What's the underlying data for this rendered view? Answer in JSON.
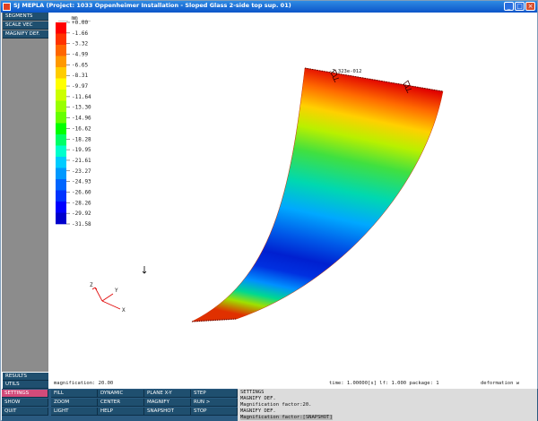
{
  "window": {
    "title": "SJ MEPLA (Project: 1033 Oppenheimer Installation - Sloped Glass 2-side top sup. 01)",
    "min": "_",
    "max": "□",
    "close": "×"
  },
  "sidebar": {
    "top_items": [
      "SEGMENTS",
      "SCALE VEC",
      "MAGNIFY DEF."
    ],
    "bottom_items": [
      "RESULTS",
      "UTILS",
      "SETTINGS",
      "SHOW",
      "QUIT"
    ]
  },
  "legend": {
    "unit": "___ mm ___",
    "colors": [
      "#ff0000",
      "#ff3300",
      "#ff6600",
      "#ff9900",
      "#ffcc00",
      "#ffff00",
      "#ccff00",
      "#99ff00",
      "#66ff00",
      "#00ff00",
      "#00ff66",
      "#00ffcc",
      "#00ccff",
      "#0099ff",
      "#0066ff",
      "#0033ff",
      "#0000ff",
      "#0000cc"
    ],
    "values": [
      "+0.00",
      "-1.66",
      "-3.32",
      "-4.99",
      "-6.65",
      "-8.31",
      "-9.97",
      "-11.64",
      "-13.30",
      "-14.96",
      "-16.62",
      "-18.28",
      "-19.95",
      "-21.61",
      "-23.27",
      "-24.93",
      "-26.60",
      "-28.26",
      "-29.92",
      "-31.58"
    ]
  },
  "plot": {
    "annotation_max": "-7.323e-012",
    "axis_x": "X",
    "axis_y": "Y",
    "axis_z": "Z"
  },
  "status": {
    "magnification": "magnification: 20.00",
    "time": "time:  1.00000[s] lf:  1.000 package: 1",
    "mode": "deformation w"
  },
  "menu": {
    "columns": [
      [
        "FILL",
        "ZOOM",
        "LIGHT"
      ],
      [
        "DYNAMIC",
        "CENTER",
        "HELP"
      ],
      [
        "PLANE X-Y",
        "MAGNIFY",
        "SNAPSHOT"
      ],
      [
        "STEP",
        "RUN  >",
        "STOP"
      ]
    ]
  },
  "console": {
    "lines": [
      "SETTINGS",
      "MAGNIFY DEF.",
      "Magnification factor:20.",
      "MAGNIFY DEF.",
      "Magnification factor:[SNAPSHOT]"
    ]
  }
}
